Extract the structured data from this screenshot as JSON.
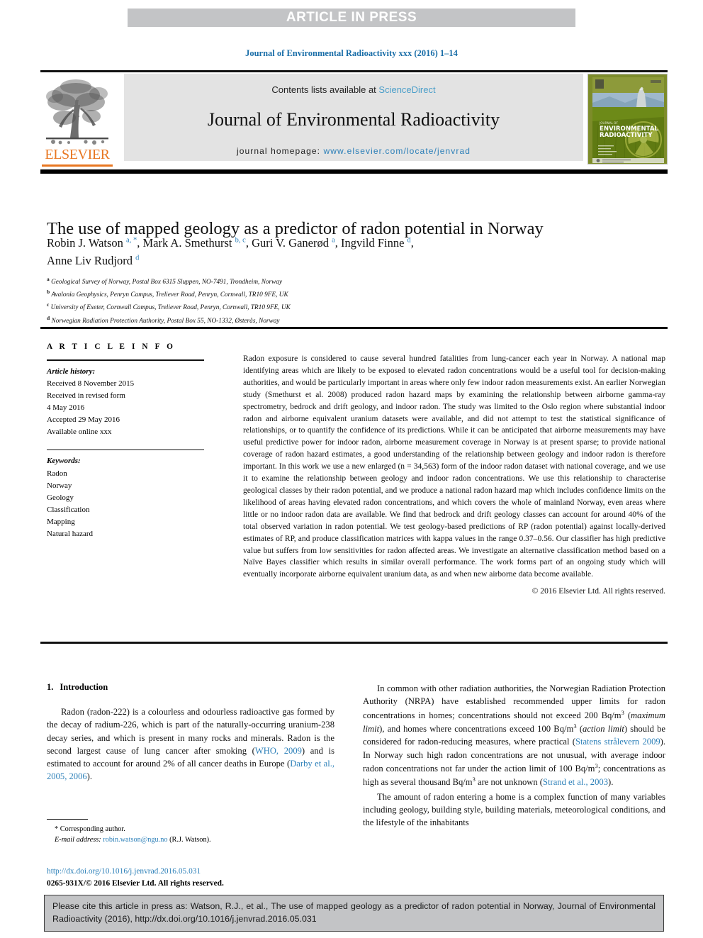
{
  "banner": {
    "text": "ARTICLE IN PRESS"
  },
  "running_head": "Journal of Environmental Radioactivity xxx (2016) 1–14",
  "masthead": {
    "publisher": "ELSEVIER",
    "contents_prefix": "Contents lists available at ",
    "contents_link": "ScienceDirect",
    "journal_name": "Journal of Environmental Radioactivity",
    "homepage_prefix": "journal homepage: ",
    "homepage_url": "www.elsevier.com/locate/jenvrad",
    "cover_title_line1": "JOURNAL OF",
    "cover_title_line2": "ENVIRONMENTAL",
    "cover_title_line3": "RADIOACTIVITY"
  },
  "article": {
    "title": "The use of mapped geology as a predictor of radon potential in Norway",
    "authors": [
      {
        "name": "Robin J. Watson",
        "marks": "a, *",
        "sep": ", "
      },
      {
        "name": "Mark A. Smethurst",
        "marks": "b, c",
        "sep": ", "
      },
      {
        "name": "Guri V. Ganerød",
        "marks": "a",
        "sep": ", "
      },
      {
        "name": "Ingvild Finne",
        "marks": "d",
        "sep": ","
      },
      {
        "name": "Anne Liv Rudjord",
        "marks": "d",
        "sep": ""
      }
    ],
    "affiliations": [
      {
        "mark": "a",
        "text": "Geological Survey of Norway, Postal Box 6315 Sluppen, NO-7491, Trondheim, Norway"
      },
      {
        "mark": "b",
        "text": "Avalonia Geophysics, Penryn Campus, Treliever Road, Penryn, Cornwall, TR10 9FE, UK"
      },
      {
        "mark": "c",
        "text": "University of Exeter, Cornwall Campus, Treliever Road, Penryn, Cornwall, TR10 9FE, UK"
      },
      {
        "mark": "d",
        "text": "Norwegian Radiation Protection Authority, Postal Box 55, NO-1332, Østerås, Norway"
      }
    ]
  },
  "article_info": {
    "heading": "A R T I C L E  I N F O",
    "history_label": "Article history:",
    "history": [
      "Received 8 November 2015",
      "Received in revised form",
      "4 May 2016",
      "Accepted 29 May 2016",
      "Available online xxx"
    ],
    "keywords_label": "Keywords:",
    "keywords": [
      "Radon",
      "Norway",
      "Geology",
      "Classification",
      "Mapping",
      "Natural hazard"
    ]
  },
  "abstract": {
    "text": "Radon exposure is considered to cause several hundred fatalities from lung-cancer each year in Norway. A national map identifying areas which are likely to be exposed to elevated radon concentrations would be a useful tool for decision-making authorities, and would be particularly important in areas where only few indoor radon measurements exist. An earlier Norwegian study (Smethurst et al. 2008) produced radon hazard maps by examining the relationship between airborne gamma-ray spectrometry, bedrock and drift geology, and indoor radon. The study was limited to the Oslo region where substantial indoor radon and airborne equivalent uranium datasets were available, and did not attempt to test the statistical significance of relationships, or to quantify the confidence of its predictions. While it can be anticipated that airborne measurements may have useful predictive power for indoor radon, airborne measurement coverage in Norway is at present sparse; to provide national coverage of radon hazard estimates, a good understanding of the relationship between geology and indoor radon is therefore important. In this work we use a new enlarged (n = 34,563) form of the indoor radon dataset with national coverage, and we use it to examine the relationship between geology and indoor radon concentrations. We use this relationship to characterise geological classes by their radon potential, and we produce a national radon hazard map which includes confidence limits on the likelihood of areas having elevated radon concentrations, and which covers the whole of mainland Norway, even areas where little or no indoor radon data are available. We find that bedrock and drift geology classes can account for around 40% of the total observed variation in radon potential. We test geology-based predictions of RP (radon potential) against locally-derived estimates of RP, and produce classification matrices with kappa values in the range 0.37–0.56. Our classifier has high predictive value but suffers from low sensitivities for radon affected areas. We investigate an alternative classification method based on a Naïve Bayes classifier which results in similar overall performance. The work forms part of an ongoing study which will eventually incorporate airborne equivalent uranium data, as and when new airborne data become available.",
    "copyright": "© 2016 Elsevier Ltd. All rights reserved."
  },
  "body": {
    "section_number": "1.",
    "section_title": "Introduction",
    "left_paragraph_parts": [
      {
        "t": "Radon (radon-222) is a colourless and odourless radioactive gas formed by the decay of radium-226, which is part of the naturally-occurring uranium-238 decay series, and which is present in many rocks and minerals. Radon is the second largest cause of lung cancer after smoking (",
        "k": "text"
      },
      {
        "t": "WHO, 2009",
        "k": "link"
      },
      {
        "t": ") and is estimated to account for around 2% of all cancer deaths in Europe (",
        "k": "text"
      },
      {
        "t": "Darby et al., 2005, 2006",
        "k": "link"
      },
      {
        "t": ").",
        "k": "text"
      }
    ],
    "right_paragraph1_parts": [
      {
        "t": "In common with other radiation authorities, the Norwegian Radiation Protection Authority (NRPA) have established recommended upper limits for radon concentrations in homes; concentrations should not exceed 200 Bq/m",
        "k": "text"
      },
      {
        "t": "3",
        "k": "sup"
      },
      {
        "t": " (",
        "k": "text"
      },
      {
        "t": "maximum limit",
        "k": "italic"
      },
      {
        "t": "), and homes where concentrations exceed 100 Bq/m",
        "k": "text"
      },
      {
        "t": "3",
        "k": "sup"
      },
      {
        "t": " (",
        "k": "text"
      },
      {
        "t": "action limit",
        "k": "italic"
      },
      {
        "t": ") should be considered for radon-reducing measures, where practical (",
        "k": "text"
      },
      {
        "t": "Statens strålevern 2009",
        "k": "link"
      },
      {
        "t": "). In Norway such high radon concentrations are not unusual, with average indoor radon concentrations not far under the action limit of 100 Bq/m",
        "k": "text"
      },
      {
        "t": "3",
        "k": "sup"
      },
      {
        "t": "; concentrations as high as several thousand Bq/m",
        "k": "text"
      },
      {
        "t": "3",
        "k": "sup"
      },
      {
        "t": " are not unknown (",
        "k": "text"
      },
      {
        "t": "Strand et al., 2003",
        "k": "link"
      },
      {
        "t": ").",
        "k": "text"
      }
    ],
    "right_paragraph2_parts": [
      {
        "t": "The amount of radon entering a home is a complex function of many variables including geology, building style, building materials, meteorological conditions, and the lifestyle of the inhabitants",
        "k": "text"
      }
    ]
  },
  "footnote": {
    "corresponding_marker": "*",
    "corresponding_text": "Corresponding author.",
    "email_label": "E-mail address:",
    "email": "robin.watson@ngu.no",
    "email_owner": "(R.J. Watson)."
  },
  "doi_block": {
    "doi_url": "http://dx.doi.org/10.1016/j.jenvrad.2016.05.031",
    "issn_line": "0265-931X/© 2016 Elsevier Ltd. All rights reserved."
  },
  "cite_box": {
    "text": "Please cite this article in press as: Watson, R.J., et al., The use of mapped geology as a predictor of radon potential in Norway, Journal of Environmental Radioactivity (2016), http://dx.doi.org/10.1016/j.jenvrad.2016.05.031"
  },
  "colors": {
    "link_blue": "#2b7fb8",
    "sciencedirect_blue": "#4a9ec9",
    "elsevier_orange": "#e87722",
    "banner_gray": "#c3c4c6",
    "band_gray": "#e3e3e3"
  }
}
